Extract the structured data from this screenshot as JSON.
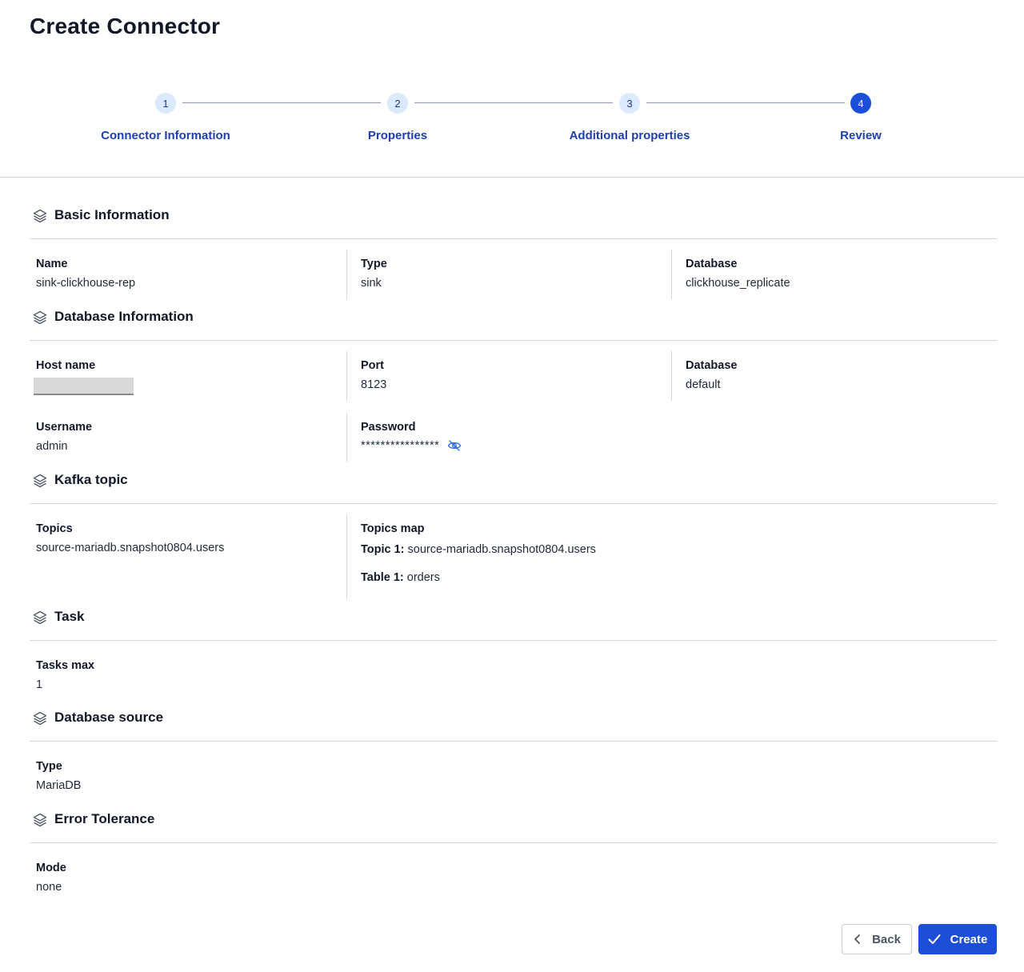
{
  "page": {
    "title": "Create Connector"
  },
  "stepper": {
    "steps": [
      {
        "number": "1",
        "label": "Connector Information",
        "active": false
      },
      {
        "number": "2",
        "label": "Properties",
        "active": false
      },
      {
        "number": "3",
        "label": "Additional properties",
        "active": false
      },
      {
        "number": "4",
        "label": "Review",
        "active": true
      }
    ]
  },
  "sections": {
    "basic": {
      "title": "Basic Information",
      "name_label": "Name",
      "name_value": "sink-clickhouse-rep",
      "type_label": "Type",
      "type_value": "sink",
      "database_label": "Database",
      "database_value": "clickhouse_replicate"
    },
    "database_info": {
      "title": "Database Information",
      "host_label": "Host name",
      "port_label": "Port",
      "port_value": "8123",
      "database_label": "Database",
      "database_value": "default",
      "username_label": "Username",
      "username_value": "admin",
      "password_label": "Password",
      "password_value": "****************"
    },
    "kafka": {
      "title": "Kafka topic",
      "topics_label": "Topics",
      "topics_value": "source-mariadb.snapshot0804.users",
      "topics_map_label": "Topics map",
      "topic1_key": "Topic 1:",
      "topic1_value": "source-mariadb.snapshot0804.users",
      "table1_key": "Table 1:",
      "table1_value": "orders"
    },
    "task": {
      "title": "Task",
      "tasks_max_label": "Tasks max",
      "tasks_max_value": "1"
    },
    "db_source": {
      "title": "Database source",
      "type_label": "Type",
      "type_value": "MariaDB"
    },
    "error_tolerance": {
      "title": "Error Tolerance",
      "mode_label": "Mode",
      "mode_value": "none"
    }
  },
  "buttons": {
    "back_label": "Back",
    "create_label": "Create"
  },
  "icons": {
    "section": "layers-icon",
    "password_toggle": "eye-off-icon",
    "back": "chevron-left-icon",
    "create": "check-icon"
  },
  "colors": {
    "primary": "#1d4ed8",
    "step_inactive_bg": "#dbeafe",
    "step_label": "#1e40af"
  }
}
